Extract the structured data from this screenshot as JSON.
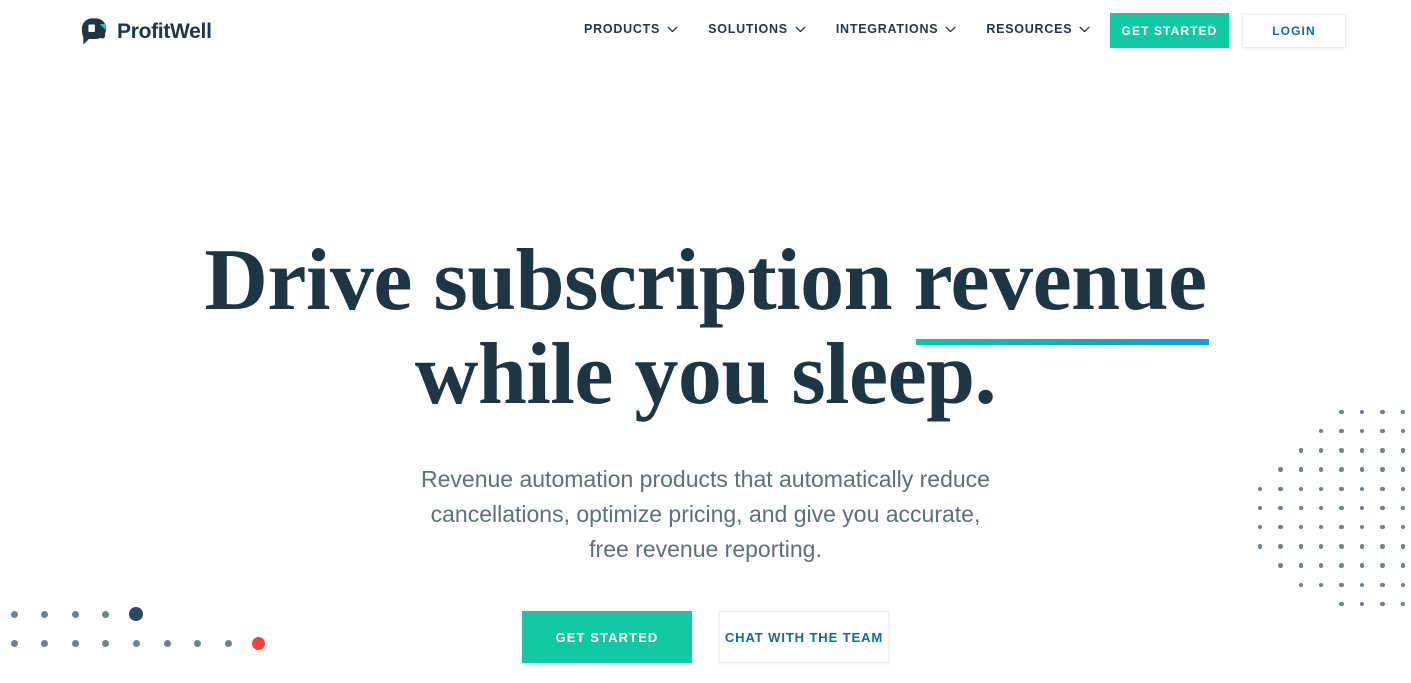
{
  "brand": {
    "name": "ProfitWell",
    "logo_icon": "profitwell-logo-icon",
    "navy": "#1e3644",
    "teal": "#0fc9a4",
    "blue": "#0f6e91",
    "red": "#f9423a",
    "gray_dot": "#6b8490"
  },
  "header": {
    "nav_items": [
      {
        "label": "PRODUCTS",
        "icon": "chevron-down-icon"
      },
      {
        "label": "SOLUTIONS",
        "icon": "chevron-down-icon"
      },
      {
        "label": "INTEGRATIONS",
        "icon": "chevron-down-icon"
      },
      {
        "label": "RESOURCES",
        "icon": "chevron-down-icon"
      }
    ],
    "get_started_label": "GET STARTED",
    "login_label": "LOGIN"
  },
  "hero": {
    "headline_line1_a": "Drive subscription ",
    "headline_line1_b": "revenue",
    "headline_line2": "while you sleep.",
    "subhead_line1": "Revenue automation products that automatically reduce",
    "subhead_line2": "cancellations, optimize pricing, and give you accurate,",
    "subhead_line3": "free revenue reporting.",
    "cta_primary_label": "GET STARTED",
    "cta_secondary_label": "CHAT WITH THE TEAM",
    "underline_gradient_from": "#00c9a4",
    "underline_gradient_to": "#00a3e0"
  },
  "decoration": {
    "left_dots": {
      "row1": {
        "small_count": 4,
        "accent_color": "#2d4a5e",
        "accent_label": "navy-dot"
      },
      "row2": {
        "small_count": 8,
        "accent_color": "#f9423a",
        "accent_label": "red-dot"
      }
    },
    "right_dots": {
      "pattern": "diamond-grid",
      "color": "#6b8490"
    }
  }
}
